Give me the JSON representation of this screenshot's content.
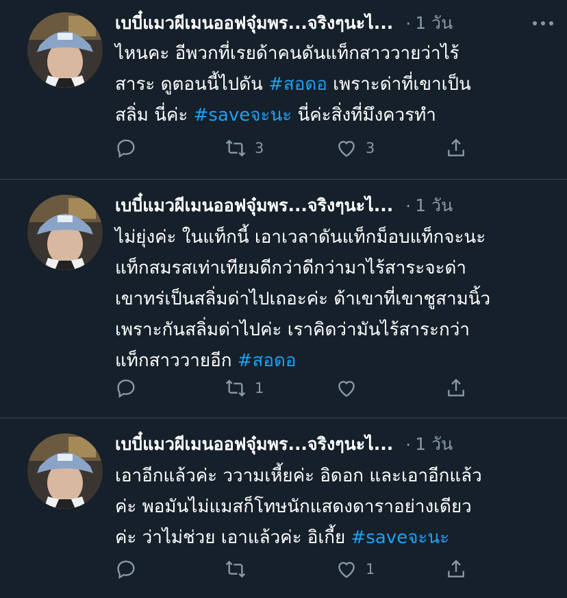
{
  "tweets": [
    {
      "display_name": "เบบี๋แมวผีเมนออฟจุ๋มพร...จริงๆนะไ...",
      "separator": "·",
      "time": "1 วัน",
      "segments": [
        {
          "text": "ไหนคะ อีพวกที่เรยด้าคนดันแท็กสาววายว่าไร้",
          "tag": false
        },
        {
          "text": "\n",
          "tag": false
        },
        {
          "text": "สาระ ดูตอนนี้ไปดัน ",
          "tag": false
        },
        {
          "text": "#สอดอ",
          "tag": true
        },
        {
          "text": " เพราะด่าที่เขาเป็น",
          "tag": false
        },
        {
          "text": "\n",
          "tag": false
        },
        {
          "text": "สลิ่ม นี่ค่ะ ",
          "tag": false
        },
        {
          "text": "#saveจะนะ",
          "tag": true
        },
        {
          "text": " นี่ค่ะสิ่งที่มึงควรทำ",
          "tag": false
        }
      ],
      "reply_count": "",
      "retweet_count": "3",
      "like_count": "3"
    },
    {
      "display_name": "เบบี๋แมวผีเมนออฟจุ๋มพร...จริงๆนะไ...",
      "separator": "·",
      "time": "1 วัน",
      "segments": [
        {
          "text": "ไม่ยุ่งค่ะ ในแท็กนี้ เอาเวลาดันแท็กม็อบแท็กจะนะ",
          "tag": false
        },
        {
          "text": "\n",
          "tag": false
        },
        {
          "text": "แท็กสมรสเท่าเทียมดีกว่าดีกว่ามาไร้สาระจะด่า",
          "tag": false
        },
        {
          "text": "\n",
          "tag": false
        },
        {
          "text": "เขาทร่เป็นสลิ่มด่าไปเถอะค่ะ ด้าเขาที่เขาชูสามนิ้ว",
          "tag": false
        },
        {
          "text": "\n",
          "tag": false
        },
        {
          "text": "เพราะกันสลิ่มด่าไปค่ะ เราคิดว่ามันไร้สาระกว่า",
          "tag": false
        },
        {
          "text": "\n",
          "tag": false
        },
        {
          "text": "แท็กสาววายอีก ",
          "tag": false
        },
        {
          "text": "#สอดอ",
          "tag": true
        }
      ],
      "reply_count": "",
      "retweet_count": "1",
      "like_count": ""
    },
    {
      "display_name": "เบบี๋แมวผีเมนออฟจุ๋มพร...จริงๆนะไ...",
      "separator": "·",
      "time": "1 วัน",
      "segments": [
        {
          "text": "เอาอีกแล้วค่ะ ววามเหี้ยค่ะ อิดอก และเอาอีกแล้ว",
          "tag": false
        },
        {
          "text": "\n",
          "tag": false
        },
        {
          "text": "ค่ะ พอมันไม่แมสก็โทษนักแสดงดาราอย่างเดียว",
          "tag": false
        },
        {
          "text": "\n",
          "tag": false
        },
        {
          "text": "ค่ะ ว่าไม่ช่วย เอาแล้วค่ะ อิเกี้ย  ",
          "tag": false
        },
        {
          "text": "#saveจะนะ",
          "tag": true
        }
      ],
      "reply_count": "",
      "retweet_count": "",
      "like_count": "1"
    }
  ],
  "icons": {
    "avatar": "avatar-photo",
    "more": "more-horizontal-icon",
    "reply": "reply-icon",
    "retweet": "retweet-icon",
    "like": "heart-icon",
    "share": "share-icon"
  },
  "colors": {
    "background": "#15202b",
    "text": "#ffffff",
    "secondary": "#8899a6",
    "hashtag": "#1da1f2",
    "divider": "#38444d"
  }
}
